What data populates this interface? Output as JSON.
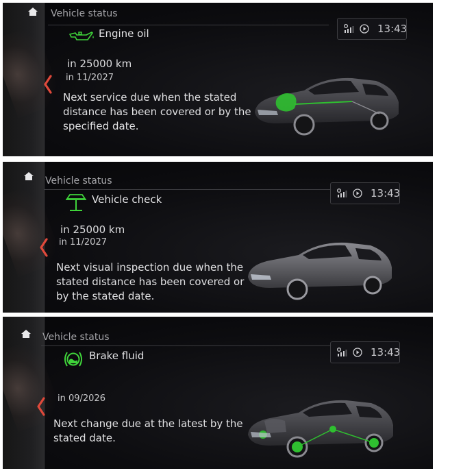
{
  "colors": {
    "accent_green": "#3fd43a",
    "back_arrow_red": "#e0493b",
    "text_primary": "#e0e0e2",
    "text_secondary": "#a6a6aa"
  },
  "screens": [
    {
      "title": "Vehicle status",
      "item_icon": "oil-can-icon",
      "item_label": "Engine oil",
      "distance": "in 25000 km",
      "date": "in 11/2027",
      "description_lines": [
        "Next service due when the stated",
        "distance has been covered or by the",
        "specified date."
      ],
      "clock": "13:43",
      "car_highlight": "engine"
    },
    {
      "title": "Vehicle status",
      "item_icon": "car-lift-icon",
      "item_label": "Vehicle check",
      "distance": "in 25000 km",
      "date": "in 11/2027",
      "description_lines": [
        "Next visual inspection due when the",
        "stated distance has been covered or",
        "by the stated date."
      ],
      "clock": "13:43",
      "car_highlight": "none"
    },
    {
      "title": "Vehicle status",
      "item_icon": "brake-warning-icon",
      "item_label": "Brake fluid",
      "date": "in 09/2026",
      "description_lines": [
        "Next change due at the latest by the",
        "stated date."
      ],
      "clock": "13:43",
      "car_highlight": "brakes"
    }
  ]
}
